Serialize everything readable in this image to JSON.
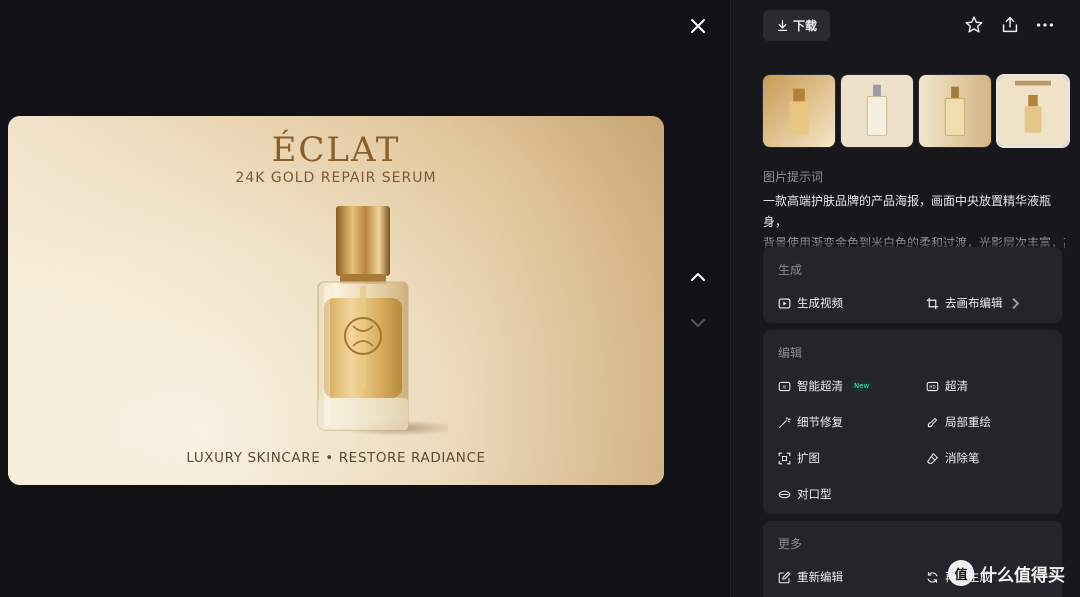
{
  "viewer": {
    "poster": {
      "brand": "ÉCLAT",
      "subtitle": "24K GOLD REPAIR SERUM",
      "tagline": "LUXURY SKINCARE • RESTORE RADIANCE"
    }
  },
  "toolbar": {
    "download_label": "下载"
  },
  "prompt": {
    "title": "图片提示词",
    "line1": "一款高端护肤品牌的产品海报，画面中央放置精华液瓶身，",
    "line2": "背景使用渐变金色到米白色的柔和过渡，光影层次丰富，高"
  },
  "sections": {
    "generate": {
      "title": "生成",
      "items": [
        {
          "label": "生成视频"
        },
        {
          "label": "去画布编辑"
        }
      ]
    },
    "edit": {
      "title": "编辑",
      "items": [
        {
          "label": "智能超清",
          "badge": "New"
        },
        {
          "label": "超清"
        },
        {
          "label": "细节修复"
        },
        {
          "label": "局部重绘"
        },
        {
          "label": "扩图"
        },
        {
          "label": "消除笔"
        },
        {
          "label": "对口型"
        }
      ]
    },
    "more": {
      "title": "更多",
      "items": [
        {
          "label": "重新编辑"
        },
        {
          "label": "再次生成"
        }
      ]
    }
  },
  "watermark": {
    "logo_text": "值",
    "text": "什么值得买"
  },
  "colors": {
    "background": "#111116",
    "panel": "#17171c",
    "card": "#24242a",
    "gold": "#8a5f2a",
    "new_badge": "#4fe3c3"
  }
}
